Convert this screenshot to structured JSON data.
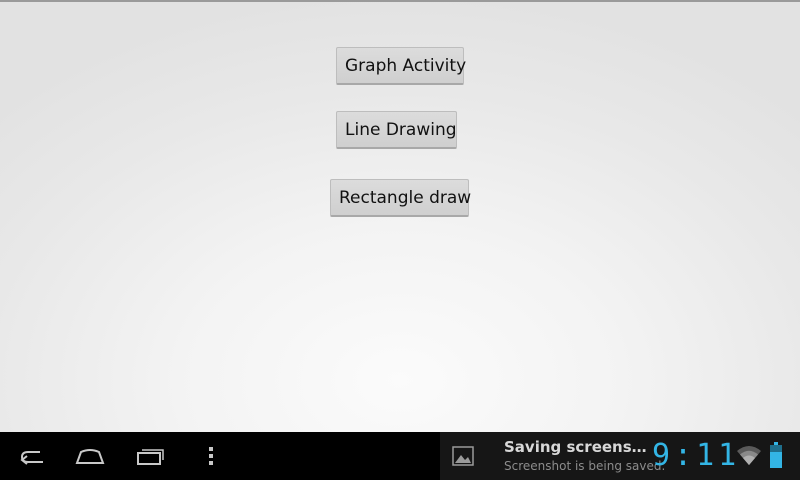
{
  "app": {
    "buttons": [
      {
        "label": "Graph Activity"
      },
      {
        "label": "Line Drawing"
      },
      {
        "label": "Rectangle draw"
      }
    ]
  },
  "system_bar": {
    "nav": {
      "back_icon": "back-arrow-icon",
      "home_icon": "home-icon",
      "recent_icon": "recent-apps-icon",
      "menu_icon": "overflow-menu-icon"
    },
    "notification": {
      "icon": "image-icon",
      "title": "Saving screenshot...",
      "subtitle": "Screenshot is being saved."
    },
    "clock": "9:11",
    "status_icons": [
      "wifi-icon",
      "battery-icon"
    ],
    "accent_color": "#33b5e5"
  }
}
